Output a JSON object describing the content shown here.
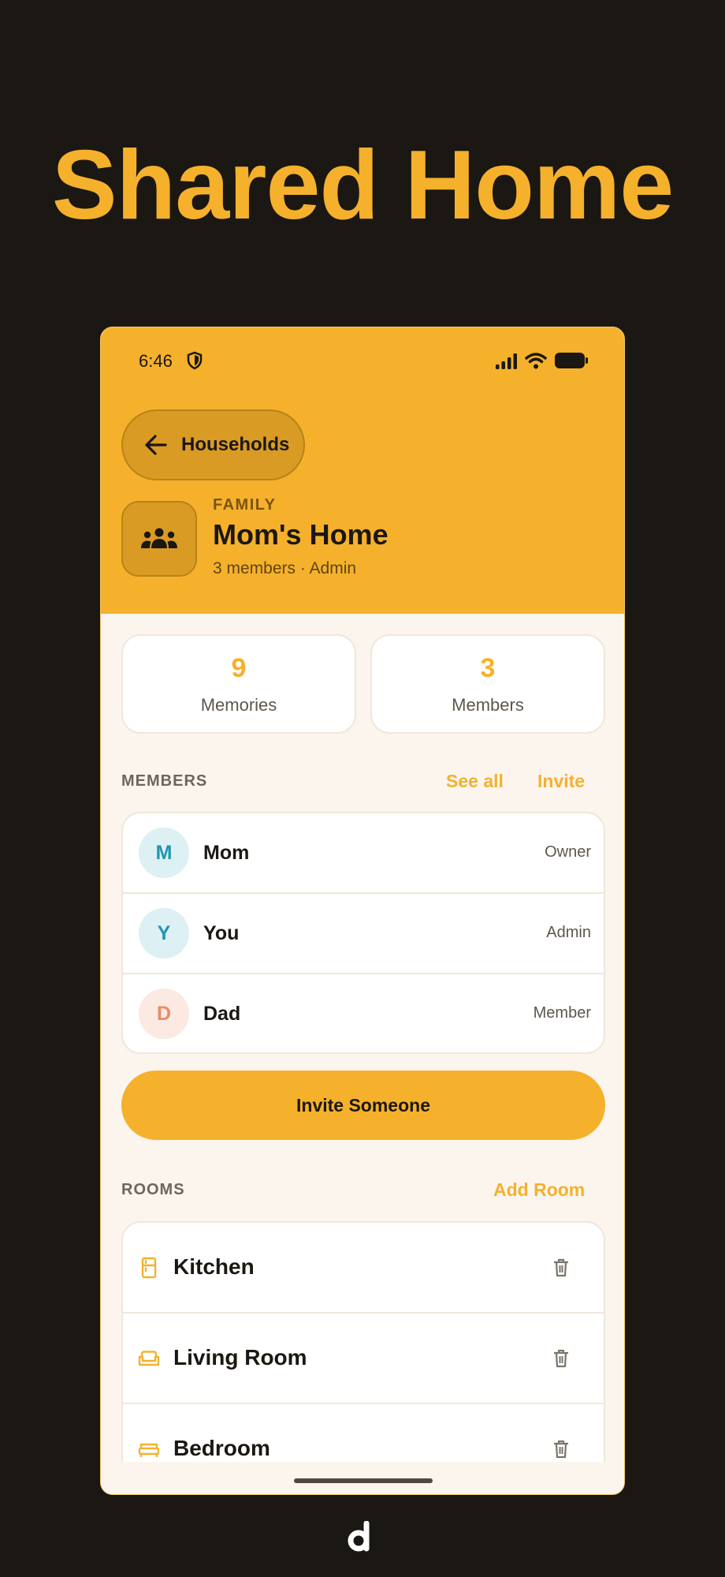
{
  "headline": "Shared Home",
  "status_bar": {
    "time": "6:46"
  },
  "header": {
    "back_label": "Households",
    "household_type": "FAMILY",
    "household_name": "Mom's Home",
    "household_meta": "3 members · Admin"
  },
  "stats": [
    {
      "value": "9",
      "label": "Memories"
    },
    {
      "value": "3",
      "label": "Members"
    }
  ],
  "members_section": {
    "title": "MEMBERS",
    "see_all": "See all",
    "invite": "Invite",
    "members": [
      {
        "initial": "M",
        "name": "Mom",
        "role": "Owner",
        "avatar_bg": "#ddf0f4",
        "avatar_fg": "#2194b0"
      },
      {
        "initial": "Y",
        "name": "You",
        "role": "Admin",
        "avatar_bg": "#ddf0f4",
        "avatar_fg": "#2194b0"
      },
      {
        "initial": "D",
        "name": "Dad",
        "role": "Member",
        "avatar_bg": "#fbe9e2",
        "avatar_fg": "#e98b66"
      }
    ]
  },
  "invite_button": "Invite Someone",
  "rooms_section": {
    "title": "ROOMS",
    "add_room": "Add Room",
    "rooms": [
      {
        "name": "Kitchen",
        "icon": "fridge-icon"
      },
      {
        "name": "Living Room",
        "icon": "sofa-icon"
      },
      {
        "name": "Bedroom",
        "icon": "bed-icon"
      }
    ]
  },
  "colors": {
    "accent": "#f5b12c",
    "background": "#1b1712",
    "screen": "#fbf5ee"
  }
}
